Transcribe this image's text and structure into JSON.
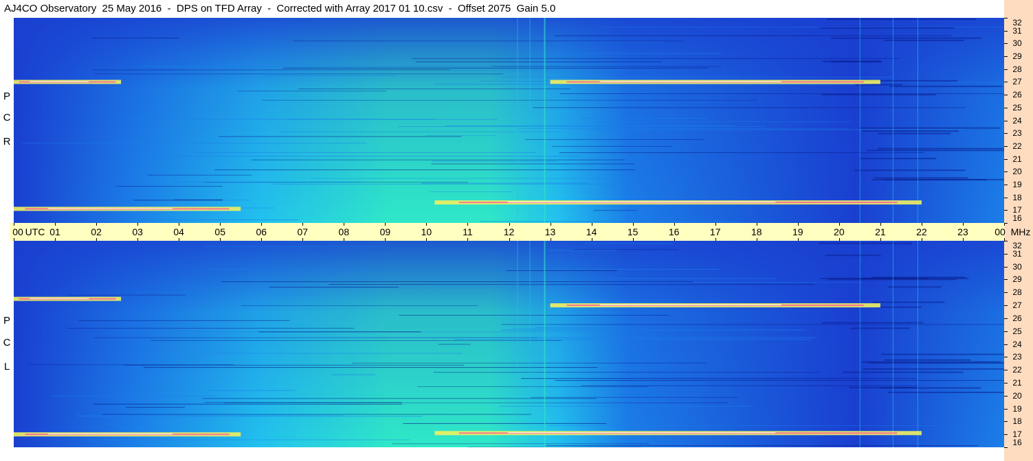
{
  "title": "AJ4CO Observatory  25 May 2016  -  DPS on TFD Array  -  Corrected with Array 2017 01 10.csv  -  Offset 2075  Gain 5.0",
  "colors": {
    "background": "#ffffff",
    "time_axis_bg": "#ffffc0",
    "freq_axis_bg": "#fedcc0",
    "palette": [
      "#071a8a",
      "#1a3fd0",
      "#1b7fe8",
      "#22c2ee",
      "#2fe8c8",
      "#80ef9a",
      "#f0f060",
      "#ff5aa0",
      "#ffffff"
    ]
  },
  "chart_data": [
    {
      "type": "heatmap",
      "panel": "upper",
      "side_label": [
        "R",
        "C",
        "P"
      ],
      "x_label": "UTC",
      "y_unit": "MHz",
      "x_ticks": [
        "00",
        "01",
        "02",
        "03",
        "04",
        "05",
        "06",
        "07",
        "08",
        "09",
        "10",
        "11",
        "12",
        "13",
        "14",
        "15",
        "16",
        "17",
        "18",
        "19",
        "20",
        "21",
        "22",
        "23",
        "00"
      ],
      "y_ticks": [
        "16",
        "17",
        "18",
        "19",
        "20",
        "21",
        "22",
        "23",
        "24",
        "25",
        "26",
        "27",
        "28",
        "29",
        "30",
        "31",
        "32"
      ],
      "x_range_hours": [
        0,
        24
      ],
      "y_range_mhz": [
        16,
        32
      ],
      "bright_bands": [
        {
          "mhz": 27.0,
          "start_utc": 0.0,
          "end_utc": 2.6
        },
        {
          "mhz": 27.0,
          "start_utc": 13.0,
          "end_utc": 21.0
        },
        {
          "mhz": 17.6,
          "start_utc": 10.2,
          "end_utc": 22.0
        },
        {
          "mhz": 17.1,
          "start_utc": 0.0,
          "end_utc": 5.5
        }
      ]
    },
    {
      "type": "heatmap",
      "panel": "lower",
      "side_label": [
        "L",
        "C",
        "P"
      ],
      "x_label": "UTC",
      "y_unit": "MHz",
      "x_ticks": [
        "00",
        "01",
        "02",
        "03",
        "04",
        "05",
        "06",
        "07",
        "08",
        "09",
        "10",
        "11",
        "12",
        "13",
        "14",
        "15",
        "16",
        "17",
        "18",
        "19",
        "20",
        "21",
        "22",
        "23",
        "00"
      ],
      "y_ticks": [
        "16",
        "17",
        "18",
        "19",
        "20",
        "21",
        "22",
        "23",
        "24",
        "25",
        "26",
        "27",
        "28",
        "29",
        "30",
        "31",
        "32"
      ],
      "x_range_hours": [
        0,
        24
      ],
      "y_range_mhz": [
        16,
        32
      ],
      "bright_bands": [
        {
          "mhz": 27.5,
          "start_utc": 0.0,
          "end_utc": 2.6
        },
        {
          "mhz": 27.0,
          "start_utc": 13.0,
          "end_utc": 21.0
        },
        {
          "mhz": 17.1,
          "start_utc": 10.2,
          "end_utc": 22.0
        },
        {
          "mhz": 17.0,
          "start_utc": 0.0,
          "end_utc": 5.5
        }
      ]
    }
  ],
  "time_axis": {
    "labels": [
      "00",
      "01",
      "02",
      "03",
      "04",
      "05",
      "06",
      "07",
      "08",
      "09",
      "10",
      "11",
      "12",
      "13",
      "14",
      "15",
      "16",
      "17",
      "18",
      "19",
      "20",
      "21",
      "22",
      "23",
      "00"
    ],
    "utc_text": "UTC",
    "mhz_text": "MHz"
  }
}
